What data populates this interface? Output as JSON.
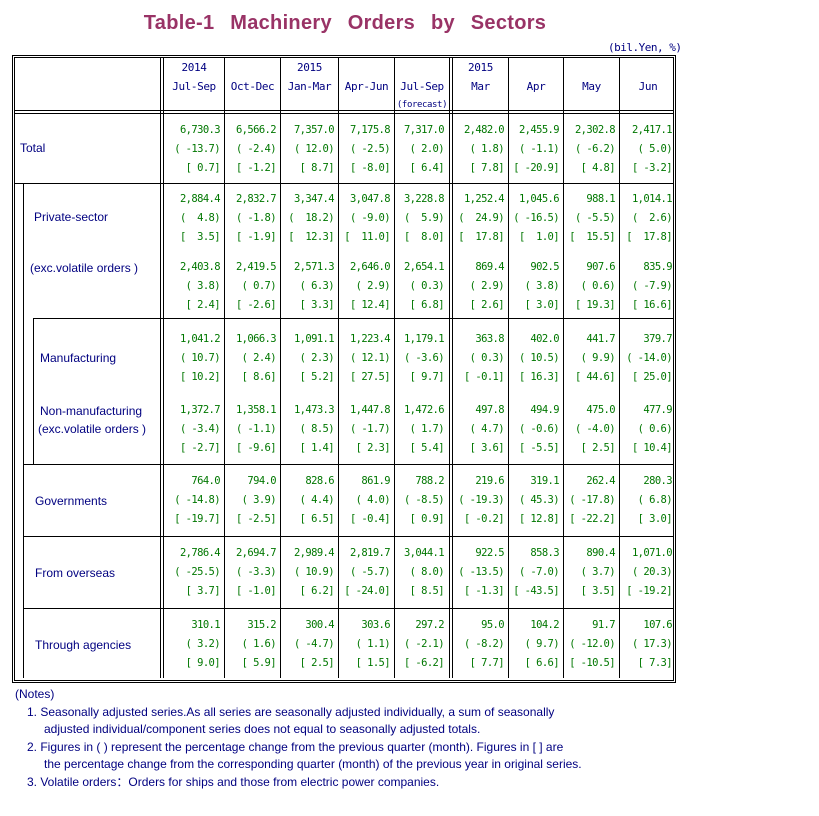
{
  "title": "Table-1   Machinery   Orders   by   Sectors",
  "unit": "(bil.Yen, %)",
  "columns": [
    {
      "year": "2014",
      "label": "Jul-Sep",
      "note": ""
    },
    {
      "year": "",
      "label": "Oct-Dec",
      "note": ""
    },
    {
      "year": "2015",
      "label": "Jan-Mar",
      "note": ""
    },
    {
      "year": "",
      "label": "Apr-Jun",
      "note": ""
    },
    {
      "year": "",
      "label": "Jul-Sep",
      "note": "(forecast)"
    },
    {
      "year": "2015",
      "label": "Mar",
      "note": ""
    },
    {
      "year": "",
      "label": "Apr",
      "note": ""
    },
    {
      "year": "",
      "label": "May",
      "note": ""
    },
    {
      "year": "",
      "label": "Jun",
      "note": ""
    }
  ],
  "rows": [
    {
      "label": "Total",
      "level": [
        "6,730.3",
        "6,566.2",
        "7,357.0",
        "7,175.8",
        "7,317.0",
        "2,482.0",
        "2,455.9",
        "2,302.8",
        "2,417.1"
      ],
      "qoq": [
        "( -13.7)",
        "( -2.4)",
        "( 12.0)",
        "( -2.5)",
        "( 2.0)",
        "( 1.8)",
        "( -1.1)",
        "( -6.2)",
        "( 5.0)"
      ],
      "yoy": [
        "[ 0.7]",
        "[ -1.2]",
        "[ 8.7]",
        "[ -8.0]",
        "[ 6.4]",
        "[ 7.8]",
        "[ -20.9]",
        "[ 4.8]",
        "[ -3.2]"
      ]
    },
    {
      "label": "Private-sector",
      "level": [
        "2,884.4",
        "2,832.7",
        "3,347.4",
        "3,047.8",
        "3,228.8",
        "1,252.4",
        "1,045.6",
        "988.1",
        "1,014.1"
      ],
      "qoq": [
        "(  4.8)",
        "( -1.8)",
        "(  18.2)",
        "( -9.0)",
        "(  5.9)",
        "(  24.9)",
        "( -16.5)",
        "( -5.5)",
        "(  2.6)"
      ],
      "yoy": [
        "[  3.5]",
        "[ -1.9]",
        "[  12.3]",
        "[  11.0]",
        "[  8.0]",
        "[  17.8]",
        "[  1.0]",
        "[  15.5]",
        "[  17.8]"
      ]
    },
    {
      "label": "(exc.volatile orders )",
      "level": [
        "2,403.8",
        "2,419.5",
        "2,571.3",
        "2,646.0",
        "2,654.1",
        "869.4",
        "902.5",
        "907.6",
        "835.9"
      ],
      "qoq": [
        "( 3.8)",
        "( 0.7)",
        "( 6.3)",
        "( 2.9)",
        "( 0.3)",
        "( 2.9)",
        "( 3.8)",
        "( 0.6)",
        "( -7.9)"
      ],
      "yoy": [
        "[ 2.4]",
        "[ -2.6]",
        "[ 3.3]",
        "[ 12.4]",
        "[ 6.8]",
        "[ 2.6]",
        "[ 3.0]",
        "[ 19.3]",
        "[ 16.6]"
      ]
    },
    {
      "label": "Manufacturing",
      "level": [
        "1,041.2",
        "1,066.3",
        "1,091.1",
        "1,223.4",
        "1,179.1",
        "363.8",
        "402.0",
        "441.7",
        "379.7"
      ],
      "qoq": [
        "( 10.7)",
        "( 2.4)",
        "( 2.3)",
        "( 12.1)",
        "( -3.6)",
        "( 0.3)",
        "( 10.5)",
        "( 9.9)",
        "( -14.0)"
      ],
      "yoy": [
        "[ 10.2]",
        "[ 8.6]",
        "[ 5.2]",
        "[ 27.5]",
        "[ 9.7]",
        "[ -0.1]",
        "[ 16.3]",
        "[ 44.6]",
        "[ 25.0]"
      ]
    },
    {
      "label": "Non-manufacturing",
      "label2": "(exc.volatile orders )",
      "level": [
        "1,372.7",
        "1,358.1",
        "1,473.3",
        "1,447.8",
        "1,472.6",
        "497.8",
        "494.9",
        "475.0",
        "477.9"
      ],
      "qoq": [
        "( -3.4)",
        "( -1.1)",
        "( 8.5)",
        "( -1.7)",
        "( 1.7)",
        "( 4.7)",
        "( -0.6)",
        "( -4.0)",
        "( 0.6)"
      ],
      "yoy": [
        "[ -2.7]",
        "[ -9.6]",
        "[ 1.4]",
        "[ 2.3]",
        "[ 5.4]",
        "[ 3.6]",
        "[ -5.5]",
        "[ 2.5]",
        "[ 10.4]"
      ]
    },
    {
      "label": "Governments",
      "level": [
        "764.0",
        "794.0",
        "828.6",
        "861.9",
        "788.2",
        "219.6",
        "319.1",
        "262.4",
        "280.3"
      ],
      "qoq": [
        "( -14.8)",
        "( 3.9)",
        "( 4.4)",
        "( 4.0)",
        "( -8.5)",
        "( -19.3)",
        "( 45.3)",
        "( -17.8)",
        "( 6.8)"
      ],
      "yoy": [
        "[ -19.7]",
        "[ -2.5]",
        "[ 6.5]",
        "[ -0.4]",
        "[ 0.9]",
        "[ -0.2]",
        "[ 12.8]",
        "[ -22.2]",
        "[ 3.0]"
      ]
    },
    {
      "label": "From overseas",
      "level": [
        "2,786.4",
        "2,694.7",
        "2,989.4",
        "2,819.7",
        "3,044.1",
        "922.5",
        "858.3",
        "890.4",
        "1,071.0"
      ],
      "qoq": [
        "( -25.5)",
        "( -3.3)",
        "( 10.9)",
        "( -5.7)",
        "( 8.0)",
        "( -13.5)",
        "( -7.0)",
        "( 3.7)",
        "( 20.3)"
      ],
      "yoy": [
        "[ 3.7]",
        "[ -1.0]",
        "[ 6.2]",
        "[ -24.0]",
        "[ 8.5]",
        "[ -1.3]",
        "[ -43.5]",
        "[ 3.5]",
        "[ -19.2]"
      ]
    },
    {
      "label": "Through agencies",
      "level": [
        "310.1",
        "315.2",
        "300.4",
        "303.6",
        "297.2",
        "95.0",
        "104.2",
        "91.7",
        "107.6"
      ],
      "qoq": [
        "( 3.2)",
        "( 1.6)",
        "( -4.7)",
        "( 1.1)",
        "( -2.1)",
        "( -8.2)",
        "( 9.7)",
        "( -12.0)",
        "( 17.3)"
      ],
      "yoy": [
        "[ 9.0]",
        "[ 5.9]",
        "[ 2.5]",
        "[ 1.5]",
        "[ -6.2]",
        "[ 7.7]",
        "[ 6.6]",
        "[ -10.5]",
        "[ 7.3]"
      ]
    }
  ],
  "notes": {
    "heading": "(Notes)",
    "items": [
      {
        "line1": "1. Seasonally adjusted series.As all series are seasonally adjusted individually, a sum of seasonally",
        "line2": "adjusted individual/component series does not equal to seasonally adjusted totals."
      },
      {
        "line1": "2. Figures in ( ) represent the percentage change from the previous quarter (month). Figures in [ ] are",
        "line2": "the percentage change from the corresponding quarter (month) of the previous year in original series."
      },
      {
        "line1": "3. Volatile orders：Orders for ships and those from electric power companies.",
        "line2": ""
      }
    ]
  }
}
